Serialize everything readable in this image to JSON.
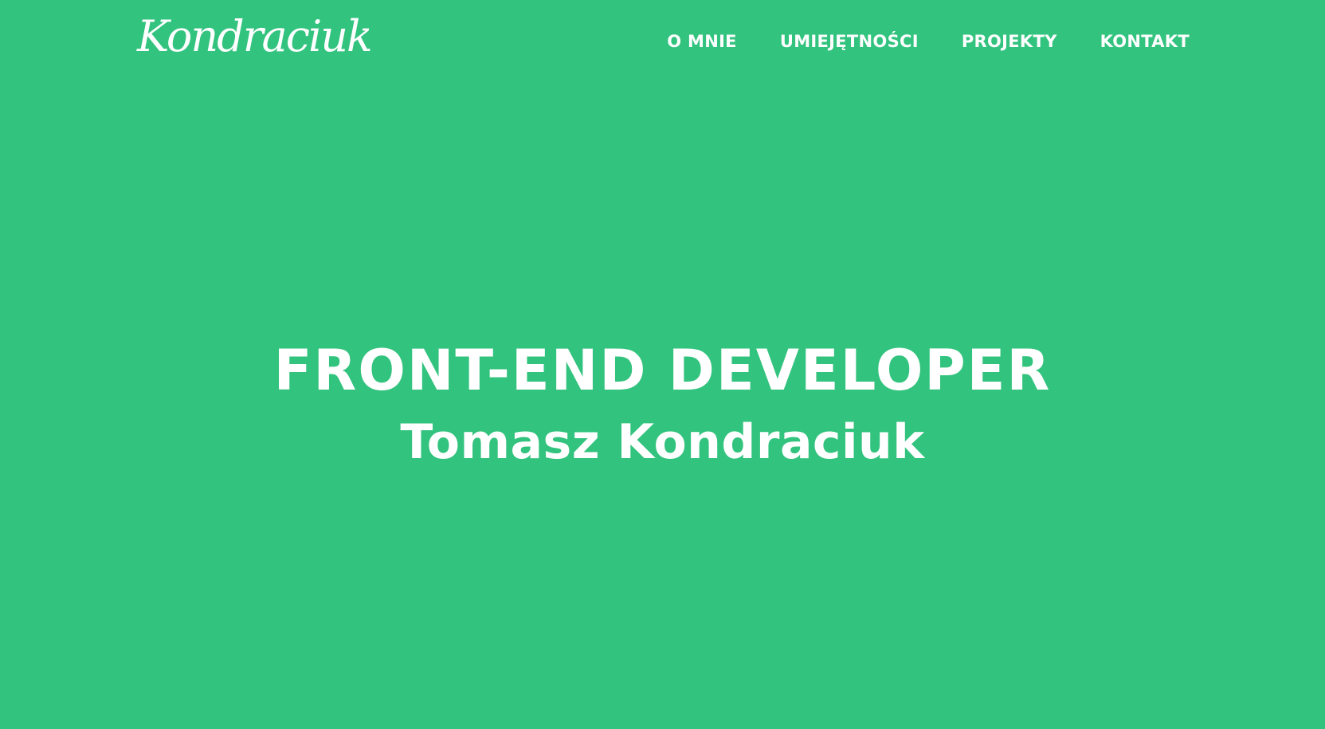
{
  "header": {
    "logo_text": "Kondraciuk",
    "nav": [
      {
        "label": "O MNIE"
      },
      {
        "label": "UMIEJĘTNOŚCI"
      },
      {
        "label": "PROJEKTY"
      },
      {
        "label": "KONTAKT"
      }
    ]
  },
  "hero": {
    "title": "FRONT-END DEVELOPER",
    "subtitle": "Tomasz Kondraciuk"
  },
  "colors": {
    "background": "#32c37e",
    "text": "#ffffff"
  }
}
